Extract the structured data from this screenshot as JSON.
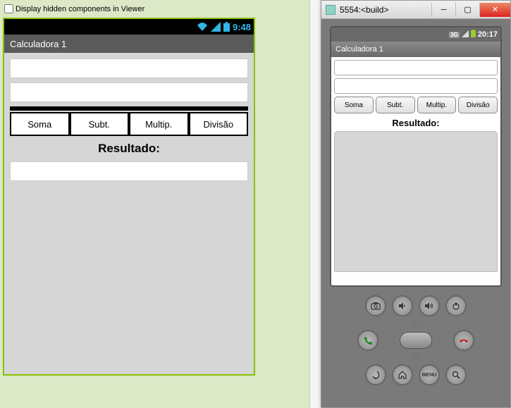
{
  "viewer": {
    "checkbox_label": "Display hidden components in Viewer",
    "status_time": "9:48",
    "app_title": "Calculadora 1",
    "buttons": {
      "soma": "Soma",
      "subt": "Subt.",
      "multip": "Multip.",
      "divisao": "Divisão"
    },
    "result_label": "Resultado:"
  },
  "emulator": {
    "window_title": "5554:<build>",
    "status_time": "20:17",
    "status_3g": "3G",
    "app_title": "Calculadora 1",
    "buttons": {
      "soma": "Soma",
      "subt": "Subt.",
      "multip": "Multip.",
      "divisao": "Divisão"
    },
    "result_label": "Resultado:",
    "menu_label": "MENU"
  }
}
